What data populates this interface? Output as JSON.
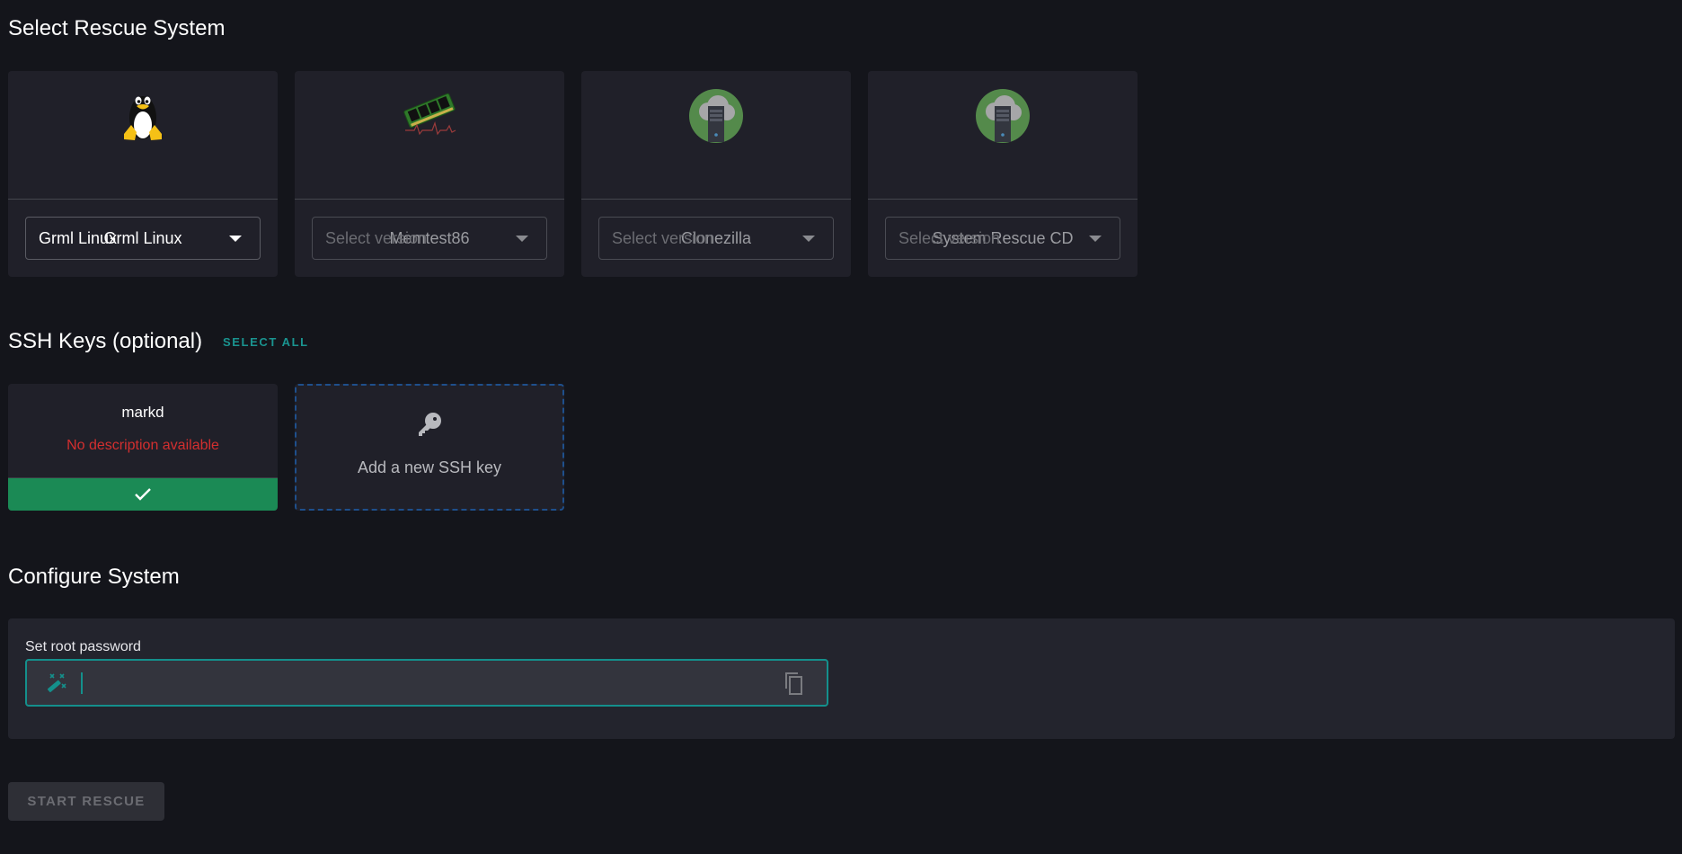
{
  "rescue_section": {
    "title": "Select Rescue System",
    "systems": [
      {
        "name": "Grml Linux",
        "icon": "tux-penguin-icon",
        "selected_version": "Grml Linux",
        "placeholder": "Select version",
        "active": true
      },
      {
        "name": "Memtest86",
        "icon": "memory-module-icon",
        "selected_version": "",
        "placeholder": "Select version",
        "active": false
      },
      {
        "name": "Clonezilla",
        "icon": "cloud-server-icon",
        "selected_version": "",
        "placeholder": "Select version",
        "active": false
      },
      {
        "name": "System Rescue CD",
        "icon": "cloud-server-icon",
        "selected_version": "",
        "placeholder": "Select version",
        "active": false
      }
    ]
  },
  "ssh_section": {
    "title": "SSH Keys (optional)",
    "select_all_label": "SELECT ALL",
    "keys": [
      {
        "name": "markd",
        "description": "No description available",
        "selected": true
      }
    ],
    "add_key_label": "Add a new SSH key"
  },
  "config_section": {
    "title": "Configure System",
    "root_password_label": "Set root password",
    "root_password_value": ""
  },
  "start_button_label": "START RESCUE",
  "colors": {
    "accent": "#14908c",
    "selected_green": "#1b8a55",
    "error_red": "#d32f2f",
    "dashed_blue": "#1e4f8c"
  }
}
